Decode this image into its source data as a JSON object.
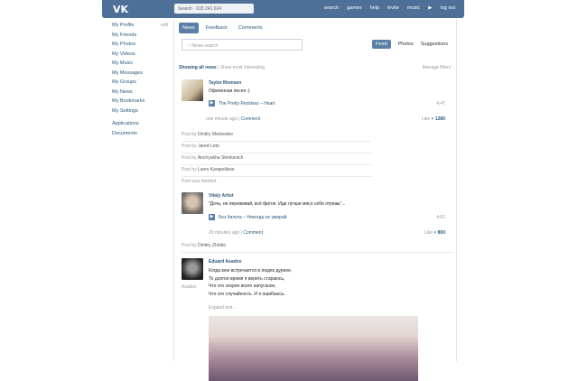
{
  "header": {
    "logo": "VK",
    "search": "Search · 633 241 624",
    "nav": [
      "search",
      "games",
      "help",
      "invite",
      "music",
      "log out"
    ]
  },
  "sidebar": {
    "edit": "edit",
    "items": [
      "My Profile",
      "My Friends",
      "My Photos",
      "My Videos",
      "My Music",
      "My Messages",
      "My Groups",
      "My News",
      "My Bookmarks",
      "My Settings"
    ],
    "extra": [
      "Applications",
      "Documents"
    ]
  },
  "tabs": [
    "News",
    "Feedback",
    "Comments"
  ],
  "feed": {
    "search_placeholder": "News search",
    "filters": [
      "Feed",
      "Photos",
      "Suggestions"
    ],
    "showing": "Showing all news",
    "show_interesting": "Show most interesting",
    "manage": "Manage filters"
  },
  "posts": [
    {
      "author": "Taylor Momsen",
      "text": "Офигенная песня :)",
      "track": "The Pretty Reckless – Heart",
      "duration": "4:47",
      "time": "one minute ago",
      "comment": "Comment",
      "like": "Like",
      "likes": "1280"
    },
    {
      "author": "Vitaly Artist",
      "text": "\"Дочь, не переживай, всё фигня. Иди лучше мясо себе отрежь\"...",
      "track": "Без билета – Никогда не умирай",
      "duration": "4:01",
      "time": "20 minutes ago",
      "comment": "Comment",
      "like": "Like",
      "likes": "800"
    },
    {
      "author": "Eduard Asadov",
      "lines": [
        "Когда мне встречается в людях дурное,",
        "То долгое время я верить стараюсь,",
        "Что это скорее всего напускное,",
        "Что это случайность. И я ошибаюсь."
      ],
      "expand": "Expand text...",
      "side": "Asadov"
    }
  ],
  "collapsed": {
    "prefix": "Post by",
    "names": [
      "Dmitry Medvedev",
      "Jared Leto",
      "Anchyukha Stenkevich",
      "Lavrs Karapsilisse"
    ],
    "deleted": "Post was deleted.",
    "last": "Dmitry Zhlobo"
  }
}
